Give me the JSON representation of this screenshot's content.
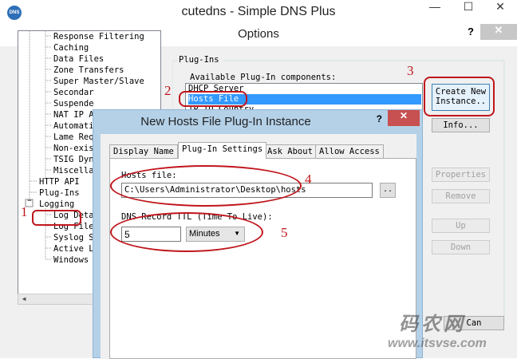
{
  "app": {
    "title": "cutedns - Simple DNS Plus",
    "icon_text": "DNS",
    "minimize": "—",
    "maximize": "☐",
    "close": "✕"
  },
  "options_dialog": {
    "title": "Options",
    "help": "?",
    "close": "✕"
  },
  "tree": {
    "items": [
      "Response Filtering",
      "Caching",
      "Data Files",
      "Zone Transfers",
      "Super Master/Slave",
      "Secondar",
      "Suspende",
      "NAT IP A",
      "Automati",
      "Lame Req",
      "Non-exis",
      "TSIG Dyn",
      "Miscella",
      "HTTP API",
      "Plug-Ins",
      "Logging",
      "Log Deta",
      "Log File",
      "Syslog S",
      "Active L",
      "Windows E"
    ],
    "collapse_glyph": "−"
  },
  "plugins": {
    "group_label": "Plug-Ins",
    "available_label": "Available Plug-In components:",
    "components": [
      "DHCP Server",
      "Hosts File",
      "IP TO Country"
    ],
    "selected_index": 1,
    "buttons": {
      "create_new_line1": "Create New",
      "create_new_line2": "Instance..",
      "info": "Info...",
      "properties": "Properties",
      "remove": "Remove",
      "up": "Up",
      "down": "Down",
      "cancel": "Can"
    }
  },
  "modal": {
    "title": "New Hosts File Plug-In Instance",
    "help": "?",
    "close": "✕",
    "tabs": [
      "Display Name",
      "Plug-In Settings",
      "Ask About",
      "Allow Access"
    ],
    "active_tab": 1,
    "hosts_file_label": "Hosts file:",
    "hosts_file_value": "C:\\Users\\Administrator\\Desktop\\hosts",
    "browse_label": "..",
    "ttl_label": "DNS Record TTL (Time To Live):",
    "ttl_value": "5",
    "ttl_unit": "Minutes",
    "ttl_unit_caret": "▼"
  },
  "annotations": {
    "labels": [
      "1",
      "2",
      "3",
      "4",
      "5"
    ],
    "color": "#c0161c"
  },
  "watermark": {
    "big": "码农网",
    "small": "www.itsvse.com"
  },
  "colors": {
    "selection": "#3399ff",
    "modal_frame": "#b4d1e8",
    "modal_close": "#c75050"
  }
}
